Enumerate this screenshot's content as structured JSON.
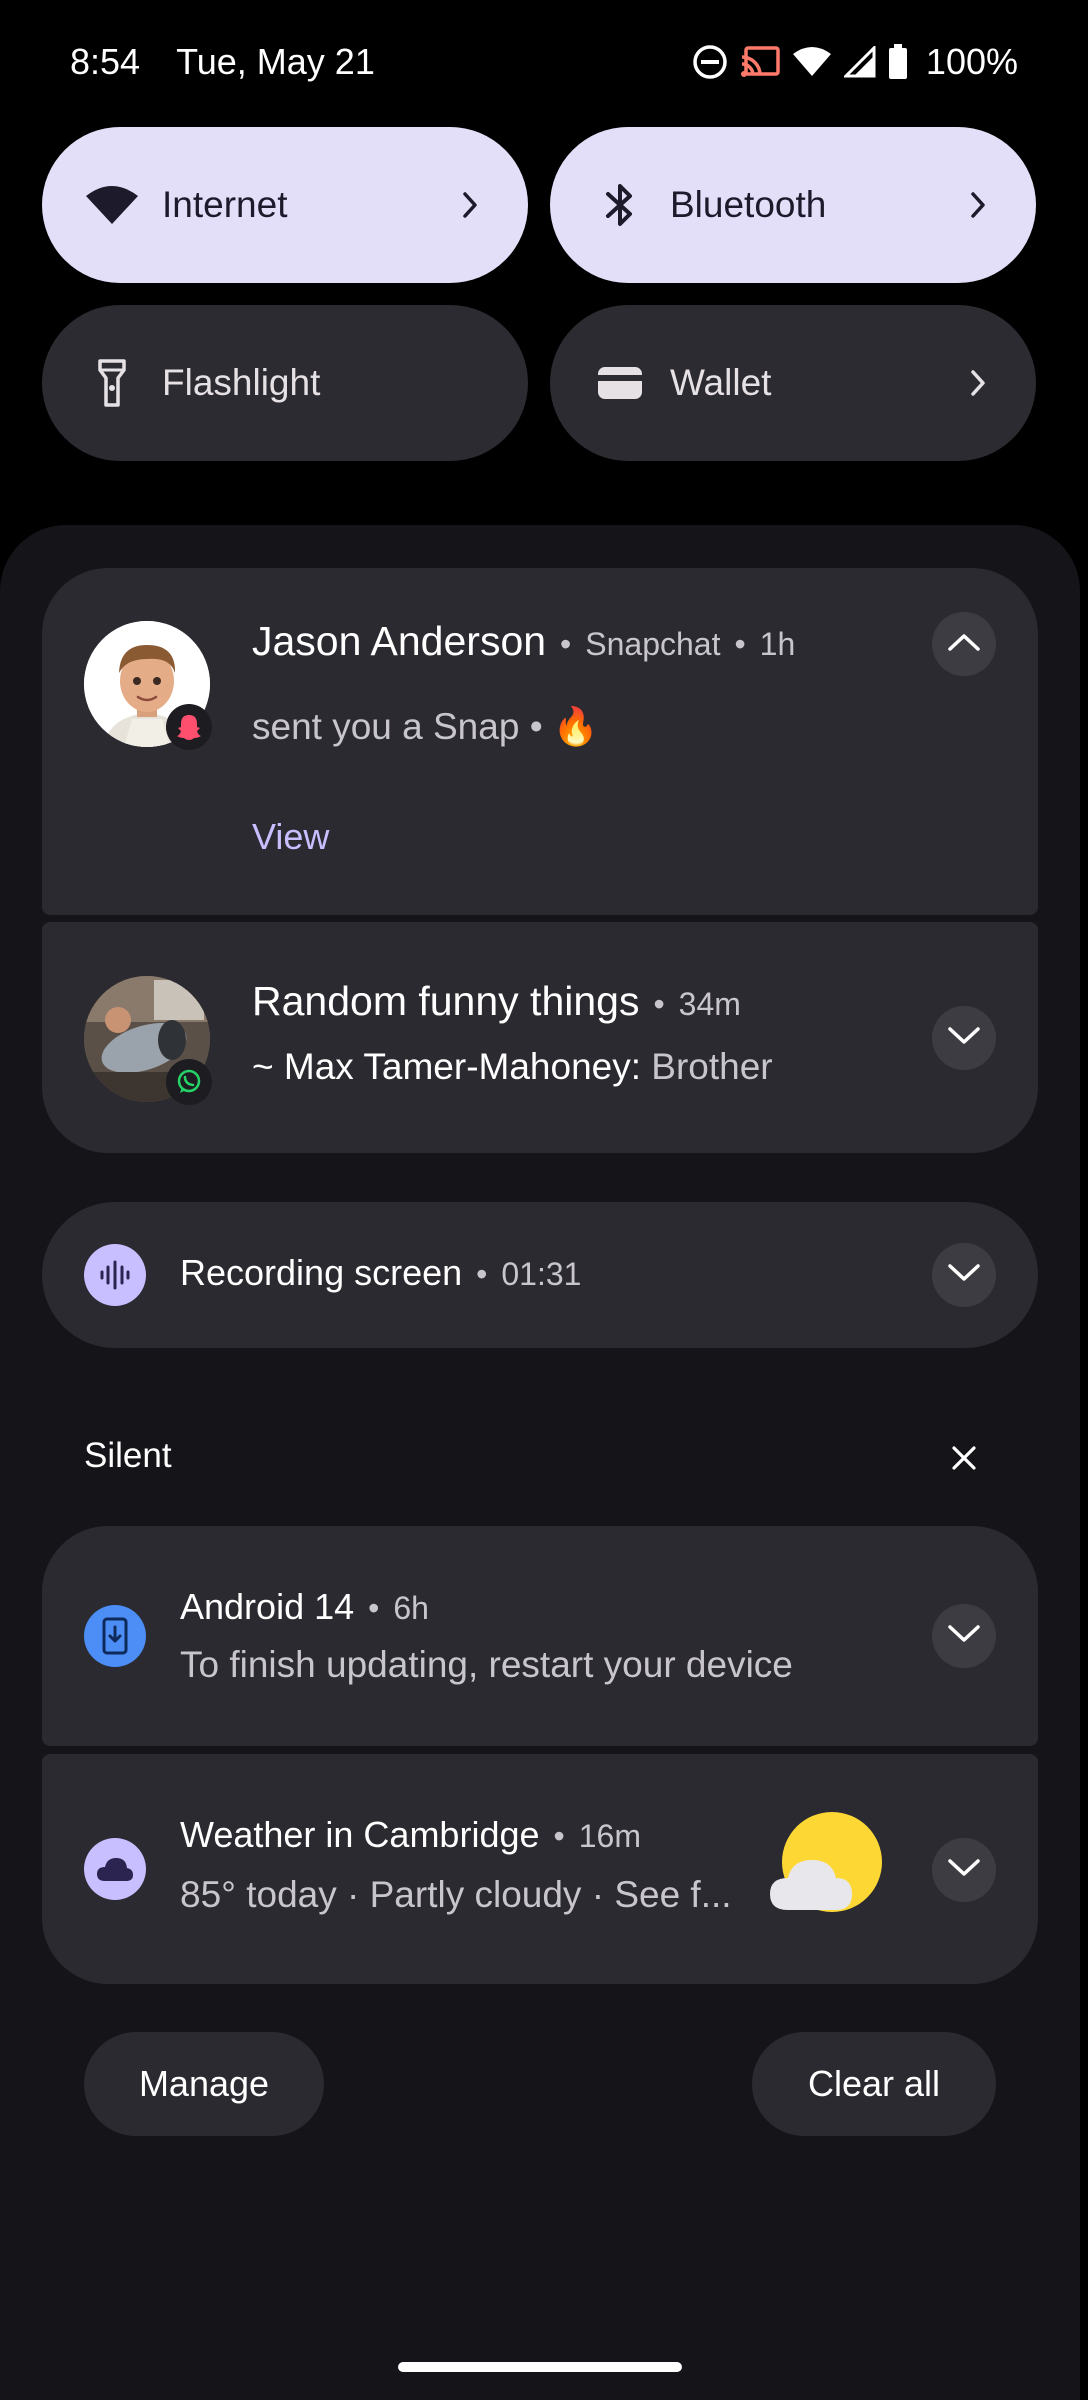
{
  "status_bar": {
    "time": "8:54",
    "date": "Tue, May 21",
    "battery": "100%",
    "icons": [
      "do-not-disturb-icon",
      "cast-icon",
      "wifi-icon",
      "cellular-signal-icon",
      "battery-icon"
    ]
  },
  "quick_tiles": [
    {
      "label": "Internet",
      "icon": "wifi-icon",
      "state": "on"
    },
    {
      "label": "Bluetooth",
      "icon": "bluetooth-icon",
      "state": "on"
    },
    {
      "label": "Flashlight",
      "icon": "flashlight-icon",
      "state": "off"
    },
    {
      "label": "Wallet",
      "icon": "wallet-icon",
      "state": "off"
    }
  ],
  "notifications": {
    "snap": {
      "sender": "Jason Anderson",
      "app": "Snapchat",
      "time": "1h",
      "message": "sent you a Snap • 🔥",
      "action": "View"
    },
    "whatsapp": {
      "group": "Random funny things",
      "time": "34m",
      "sender": "~ Max Tamer-Mahoney:",
      "message": "Brother"
    },
    "recording": {
      "title": "Recording screen",
      "elapsed": "01:31"
    },
    "silent_header": "Silent",
    "android": {
      "title": "Android 14",
      "time": "6h",
      "message": "To finish updating, restart your device"
    },
    "weather": {
      "title": "Weather in Cambridge",
      "time": "16m",
      "message": "85° today · Partly cloudy · See f..."
    }
  },
  "footer": {
    "manage": "Manage",
    "clear_all": "Clear all"
  },
  "colors": {
    "accent_tile": "#e4dff9",
    "link": "#c7bfff",
    "snap_badge": "#ff4f6e",
    "whatsapp_green": "#25d366",
    "android_blue": "#4c8df6",
    "sun_yellow": "#fdd835"
  }
}
